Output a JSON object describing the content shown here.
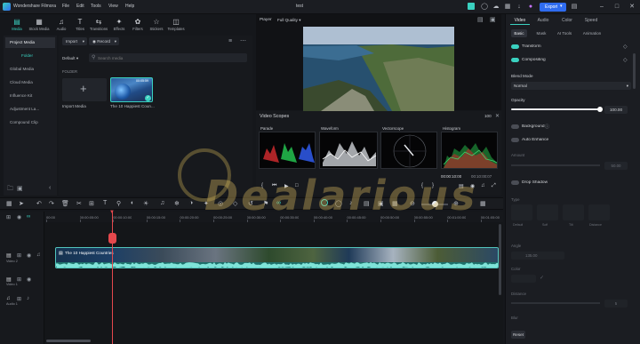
{
  "app": {
    "title": "Wondershare Filmora",
    "project": "test",
    "menu": [
      "File",
      "Edit",
      "Tools",
      "View",
      "Help"
    ],
    "export_label": "Export"
  },
  "toolbar": {
    "items": [
      {
        "label": "Media",
        "icon": "media-icon"
      },
      {
        "label": "Stock Media",
        "icon": "stock-media-icon"
      },
      {
        "label": "Audio",
        "icon": "audio-icon"
      },
      {
        "label": "Titles",
        "icon": "titles-icon"
      },
      {
        "label": "Transitions",
        "icon": "transitions-icon"
      },
      {
        "label": "Effects",
        "icon": "effects-icon"
      },
      {
        "label": "Filters",
        "icon": "filters-icon"
      },
      {
        "label": "Stickers",
        "icon": "stickers-icon"
      },
      {
        "label": "Templates",
        "icon": "templates-icon"
      }
    ]
  },
  "sidebar": {
    "items": [
      "Project Media",
      "Folder",
      "Global Media",
      "Cloud Media",
      "Influence Kit",
      "Adjustment La...",
      "Compound Clip"
    ]
  },
  "media": {
    "import_label": "Import",
    "record_label": "Record",
    "sort_label": "Default",
    "search_placeholder": "Search media",
    "folder_label": "FOLDER",
    "import_tile_label": "Import Media",
    "clip_name": "The 10 Happiest Coun...",
    "clip_duration": "00:05:59"
  },
  "player": {
    "tab": "Player",
    "quality": "Full Quality",
    "timecode_current": "00:00:10:00",
    "timecode_total": "00:10:00:07"
  },
  "scopes": {
    "title": "Video Scopes",
    "zoom": "100",
    "panels": [
      "Parade",
      "Waveform",
      "Vectorscope",
      "Histogram"
    ]
  },
  "properties": {
    "tabs": [
      "Video",
      "Audio",
      "Color",
      "Speed"
    ],
    "subtabs": [
      "Basic",
      "Mask",
      "AI Tools",
      "Animation"
    ],
    "transform": "Transform",
    "compositing": "Compositing",
    "blend_mode_label": "Blend Mode",
    "blend_mode_value": "Normal",
    "opacity_label": "Opacity",
    "opacity_value": "100.00",
    "opacity_level": 1.0,
    "background": "Background",
    "auto_enhance": "Auto Enhance",
    "amount_label": "Amount",
    "amount_value": "50.00",
    "drop_shadow": "Drop Shadow",
    "type_label": "Type",
    "shadow_types": [
      "Default",
      "Soft",
      "Tilt",
      "Distance"
    ],
    "angle_label": "Angle",
    "angle_value": "135.00",
    "color_label": "Color",
    "distance_label": "Distance",
    "distance_value": "5",
    "blur_label": "Blur",
    "reset_label": "Reset"
  },
  "timeline": {
    "ticks": [
      "00:00",
      "00:00:05:00",
      "00:00:10:00",
      "00:00:15:00",
      "00:00:20:00",
      "00:00:25:00",
      "00:00:30:00",
      "00:00:35:00",
      "00:00:40:00",
      "00:00:45:00",
      "00:00:50:00",
      "00:00:55:00",
      "00:01:00:00",
      "00:01:05:00"
    ],
    "clip_title": "The 10 Happiest Countries",
    "tracks": [
      "Video 2",
      "Video 1",
      "Audio 1"
    ]
  },
  "watermark": "Dealarious",
  "colors": {
    "accent": "#3ad1c0",
    "export_bg": "#2f6cf0",
    "playhead": "#e5484d",
    "clip": "#3aa7a0"
  }
}
